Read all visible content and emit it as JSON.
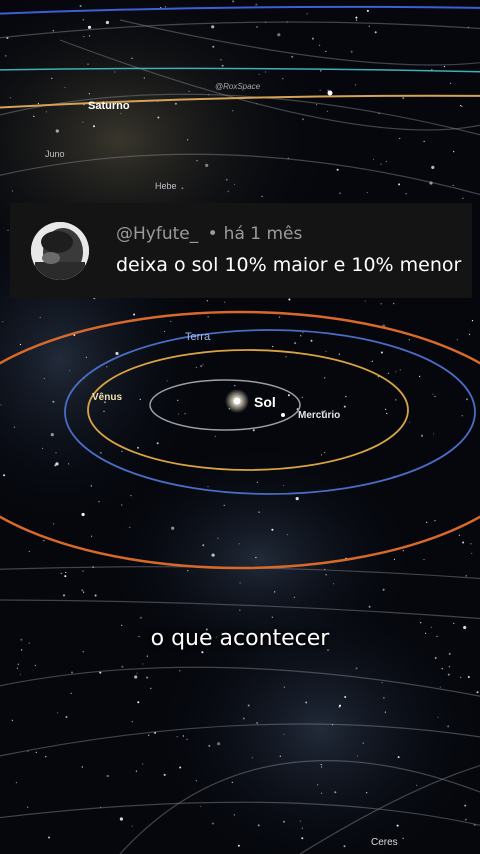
{
  "space_map": {
    "watermark": "@RoxSpace",
    "labels": {
      "saturno": "Saturno",
      "juno": "Juno",
      "hebe": "Hebe",
      "terra": "Terra",
      "venus": "Vênus",
      "sol": "Sol",
      "mercurio": "Mercúrio",
      "ceres": "Ceres"
    },
    "colors": {
      "mercurio_orbit": "#9aa0a6",
      "venus_orbit": "#d9a441",
      "terra_orbit": "#4a6cc4",
      "mars_orbit": "#d9692b",
      "saturno_orbit": "#d6a255",
      "outer_blue_orbit": "#3c5fd1",
      "outer_teal_orbit": "#3fb0b4"
    }
  },
  "comment": {
    "username": "@Hyfute_",
    "separator": "•",
    "time": "há 1 mês",
    "text": "deixa o sol 10% maior e 10% menor"
  },
  "caption": "o que acontecer"
}
